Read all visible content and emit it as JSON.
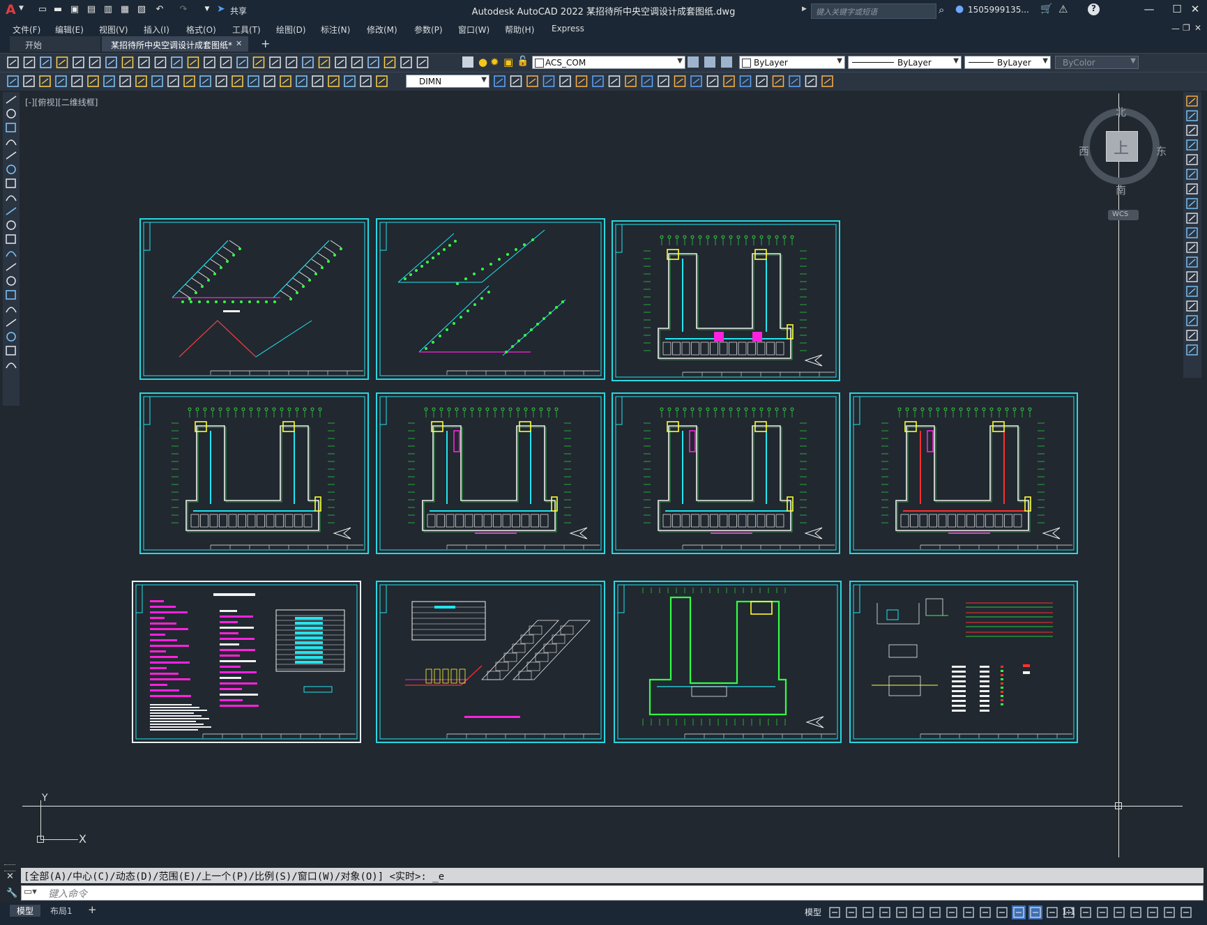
{
  "app": {
    "title": "Autodesk AutoCAD 2022    某招待所中央空调设计成套图纸.dwg",
    "share_label": "共享",
    "search_placeholder": "键入关键字或短语",
    "user_label": "1505999135...",
    "logo_letter": "A",
    "accent_color": "#d1232b"
  },
  "menu": {
    "items": [
      "文件(F)",
      "编辑(E)",
      "视图(V)",
      "插入(I)",
      "格式(O)",
      "工具(T)",
      "绘图(D)",
      "标注(N)",
      "修改(M)",
      "参数(P)",
      "窗口(W)",
      "帮助(H)",
      "Express"
    ]
  },
  "tabs": {
    "start": "开始",
    "active": "某招待所中央空调设计成套图纸*",
    "close": "✕",
    "new": "+"
  },
  "toolbar": {
    "layer_value": "ACS_COM",
    "color_value": "ByLayer",
    "linetype_value": "ByLayer",
    "lineweight_value": "ByLayer",
    "plotstyle_value": "ByColor",
    "dimstyle_value": "DIMN"
  },
  "viewport": {
    "label": "[-][俯视][二维线框]",
    "compass": {
      "north": "北",
      "south": "南",
      "east": "东",
      "west": "西",
      "top": "上",
      "wcs": "WCS"
    },
    "ucs": {
      "x": "X",
      "y": "Y"
    }
  },
  "command": {
    "history": "[全部(A)/中心(C)/动态(D)/范围(E)/上一个(P)/比例(S)/窗口(W)/对象(O)] <实时>: _e",
    "placeholder": "键入命令"
  },
  "layout_tabs": [
    "模型",
    "布局1",
    "+"
  ],
  "status": {
    "model_label": "模型",
    "scale_label": "1:1"
  },
  "sheets": [
    {
      "id": "s1",
      "kind": "isometric-a",
      "highlight": false
    },
    {
      "id": "s2",
      "kind": "isometric-b",
      "highlight": false
    },
    {
      "id": "s3",
      "kind": "plan-u",
      "highlight": false
    },
    {
      "id": "s4",
      "kind": "plan-u",
      "highlight": false
    },
    {
      "id": "s5",
      "kind": "plan-u",
      "highlight": false
    },
    {
      "id": "s6",
      "kind": "plan-u",
      "highlight": false
    },
    {
      "id": "s7",
      "kind": "plan-u",
      "highlight": false
    },
    {
      "id": "s8",
      "kind": "notes",
      "highlight": true
    },
    {
      "id": "s9",
      "kind": "iso-equipment",
      "highlight": false
    },
    {
      "id": "s10",
      "kind": "plan-roof",
      "highlight": false
    },
    {
      "id": "s11",
      "kind": "details",
      "highlight": false
    }
  ]
}
